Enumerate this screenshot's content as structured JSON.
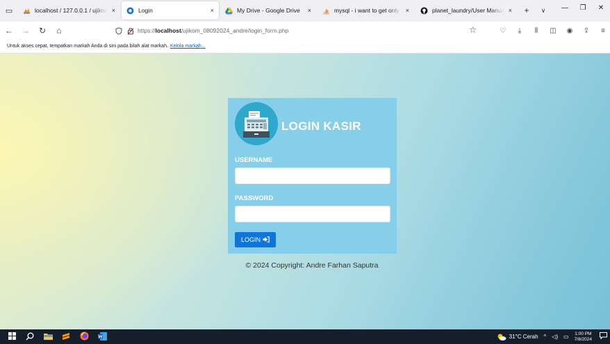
{
  "browser": {
    "tabs": [
      {
        "title": "localhost / 127.0.0.1 / ujikom",
        "icon": "phpmyadmin-icon",
        "active": false
      },
      {
        "title": "Login",
        "icon": "login-favicon-icon",
        "active": true
      },
      {
        "title": "My Drive - Google Drive",
        "icon": "google-drive-icon",
        "active": false
      },
      {
        "title": "mysql - i want to get only da",
        "icon": "stackoverflow-icon",
        "active": false
      },
      {
        "title": "planet_laundry/User Manual",
        "icon": "github-icon",
        "active": false
      }
    ],
    "tab_close_glyph": "×",
    "new_tab_glyph": "+",
    "tab_menu_glyph": "∨",
    "url_prefix": "https://",
    "url_host": "localhost",
    "url_path": "/ujikom_08092024_andre/login_form.php",
    "bookmark_bar_text": "Untuk akses cepat, tempatkan markah Anda di sini pada bilah alat markah.",
    "bookmark_bar_link": "Kelola markah..."
  },
  "page": {
    "card_title": "LOGIN KASIR",
    "username_label": "USERNAME",
    "username_value": "",
    "password_label": "PASSWORD",
    "password_value": "",
    "login_button": "LOGIN",
    "copyright": "© 2024 Copyright: Andre Farhan Saputra",
    "colors": {
      "card": "#87ceeb",
      "button": "#0f75d8",
      "icon_circle": "#2fa8cc"
    }
  },
  "taskbar": {
    "weather": "31°C  Cerah",
    "time": "1:00 PM",
    "date": "7/8/2024"
  }
}
